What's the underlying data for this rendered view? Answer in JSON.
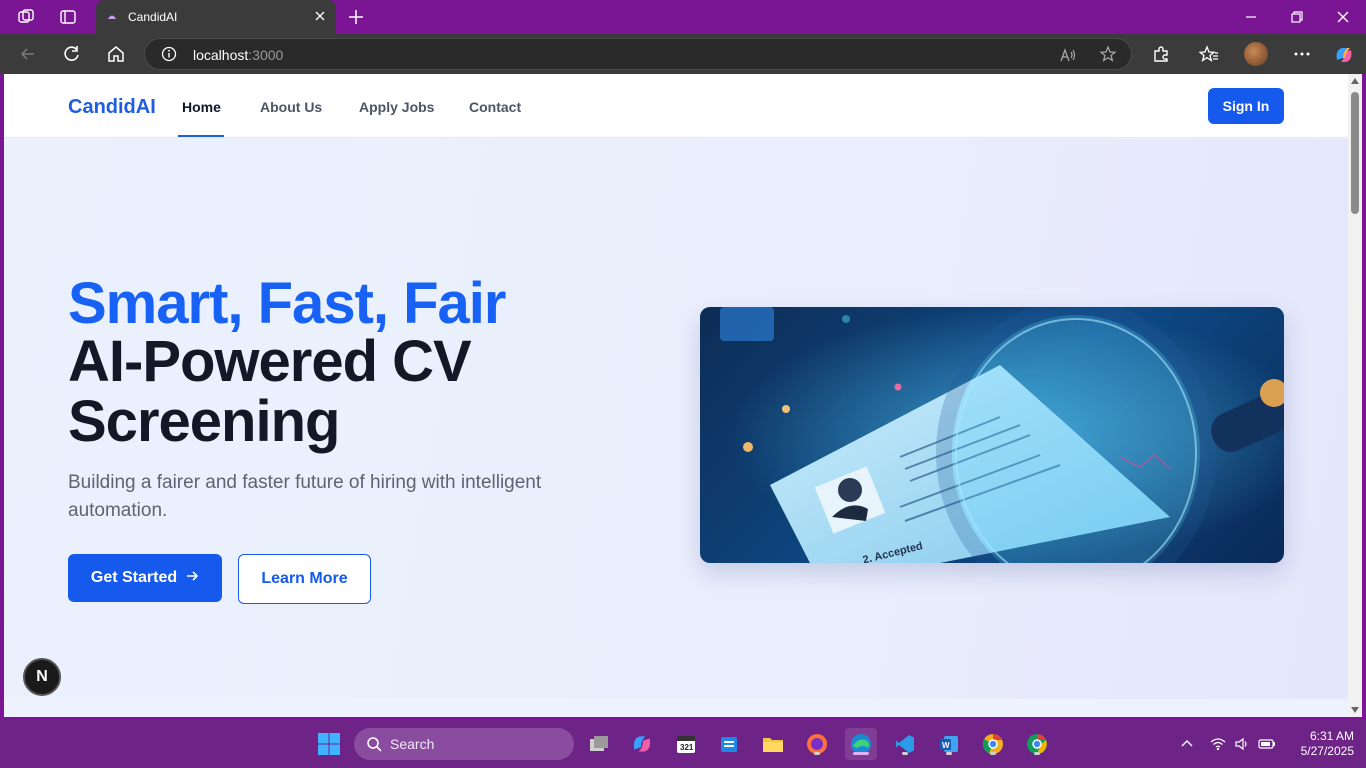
{
  "browser": {
    "tab_title": "CandidAI",
    "url_host": "localhost",
    "url_port": ":3000"
  },
  "site": {
    "brand": "CandidAI",
    "nav": [
      {
        "label": "Home",
        "active": true
      },
      {
        "label": "About Us",
        "active": false
      },
      {
        "label": "Apply Jobs",
        "active": false
      },
      {
        "label": "Contact",
        "active": false
      }
    ],
    "sign_in": "Sign In"
  },
  "hero": {
    "headline_accent": "Smart, Fast, Fair",
    "headline_line2": "AI-Powered CV",
    "headline_line3": "Screening",
    "subtitle": "Building a fairer and faster future of hiring with intelligent automation.",
    "primary_cta": "Get Started",
    "secondary_cta": "Learn More"
  },
  "dev_badge": "N",
  "taskbar": {
    "search_placeholder": "Search",
    "time": "6:31 AM",
    "date": "5/27/2025"
  },
  "colors": {
    "accent": "#1559ed",
    "brand": "#1d5fe0",
    "headline_dark": "#121826",
    "window_frame": "#7a1594"
  },
  "icons": [
    "workspaces-icon",
    "tab-actions-icon",
    "favicon-icon",
    "close-tab-icon",
    "new-tab-icon",
    "minimize-icon",
    "restore-icon",
    "close-window-icon",
    "back-icon",
    "refresh-icon",
    "home-icon",
    "info-icon",
    "read-aloud-icon",
    "favorite-star-icon",
    "extensions-icon",
    "favorites-icon",
    "profile-avatar",
    "more-icon",
    "copilot-icon",
    "arrow-right-icon",
    "windows-start-icon",
    "search-icon",
    "wifi-icon",
    "volume-icon",
    "battery-icon",
    "chevron-up-icon"
  ]
}
